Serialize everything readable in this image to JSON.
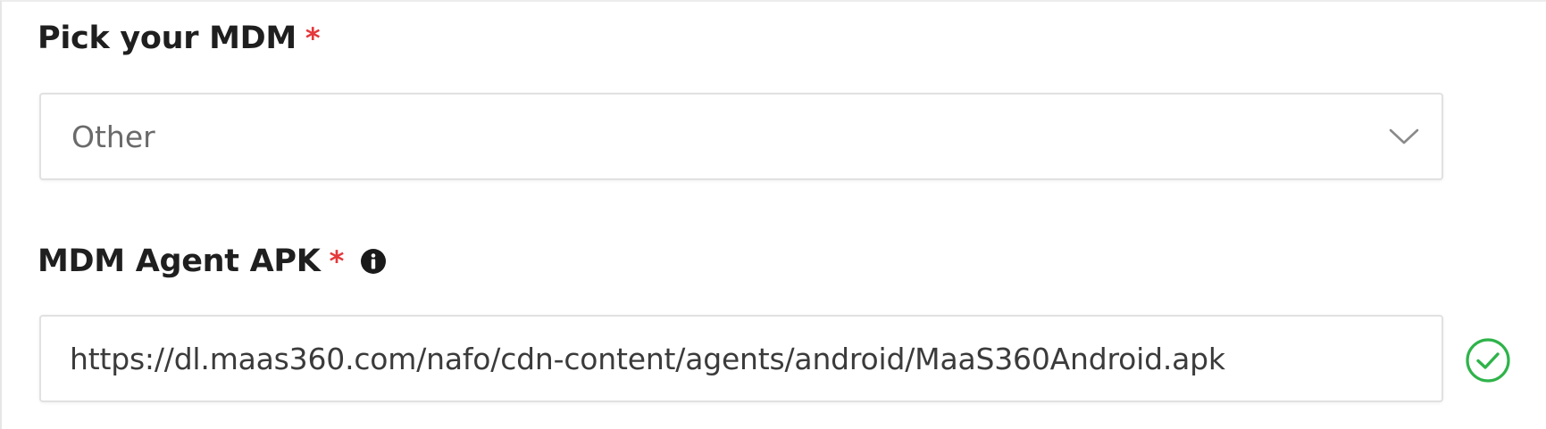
{
  "mdm_picker": {
    "label": "Pick your MDM",
    "required_marker": "*",
    "selected_value": "Other",
    "chevron_icon": "chevron-down-icon"
  },
  "agent_apk": {
    "label": "MDM Agent APK",
    "required_marker": "*",
    "info_icon": "info-icon",
    "url_value": "https://dl.maas360.com/nafo/cdn-content/agents/android/MaaS360Android.apk",
    "validation_icon": "check-circle-icon",
    "validation_color": "#2fb34a"
  },
  "colors": {
    "required": "#e5383b",
    "label_text": "#1f1f1f",
    "field_border": "#e1e1e1"
  }
}
